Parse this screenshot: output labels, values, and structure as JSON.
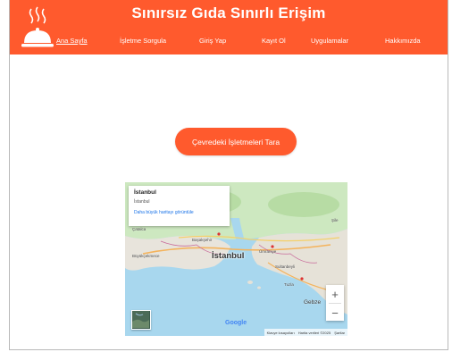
{
  "header": {
    "title": "Sınırsız Gıda Sınırlı Erişim",
    "logo_icon": "serving-cloche-icon",
    "background": "#ff5a2d"
  },
  "nav": {
    "items": [
      {
        "label": "Ana Sayfa",
        "active": true
      },
      {
        "label": "İşletme Sorgula",
        "active": false
      },
      {
        "label": "Giriş Yap",
        "active": false
      },
      {
        "label": "Kayıt Ol",
        "active": false
      },
      {
        "label": "Uygulamalar",
        "active": false
      },
      {
        "label": "Hakkımızda",
        "active": false
      }
    ]
  },
  "main": {
    "scan_button_label": "Çevredeki İşletmeleri Tara"
  },
  "map": {
    "info_card": {
      "title": "İstanbul",
      "subtitle": "İstanbul",
      "link": "Daha büyük haritayı görüntüle"
    },
    "city_label": "İstanbul",
    "labels": {
      "catalca": "Çatalca",
      "buyukcekmece": "Büyükçekmece",
      "basaksehir": "Başakşehir",
      "sile": "Şile",
      "umraniye": "Ümraniye",
      "sultanbeyli": "Sultanbeyli",
      "tuzla": "Tuzla",
      "gebze": "Gebze"
    },
    "zoom_in": "+",
    "zoom_out": "−",
    "google": "Google",
    "attribution": {
      "shortcuts": "Klavye kısayolları",
      "data": "Harita verileri ©2025",
      "terms": "Şartlar"
    }
  }
}
